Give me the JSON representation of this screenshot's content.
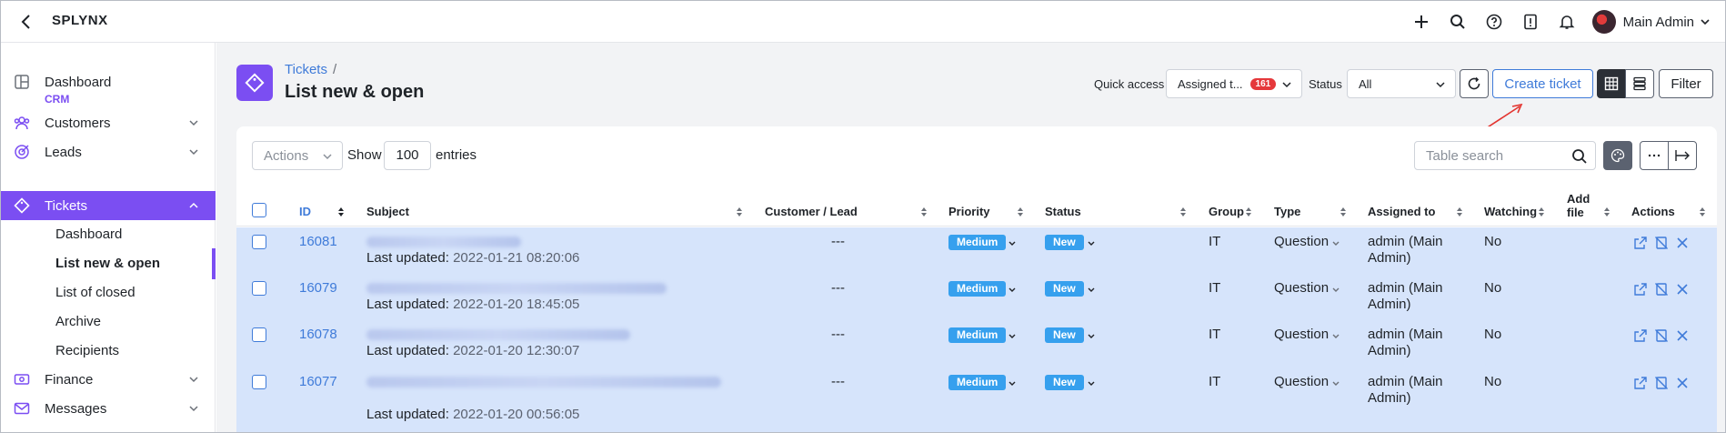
{
  "app": {
    "brand": "SPLYNX",
    "user": "Main Admin"
  },
  "sidebar": {
    "items": [
      {
        "label": "Dashboard"
      },
      {
        "label": "Customers"
      },
      {
        "label": "Leads"
      },
      {
        "label": "Tickets"
      },
      {
        "label": "Finance"
      },
      {
        "label": "Messages"
      }
    ],
    "section_crm": "CRM",
    "sub": [
      "Dashboard",
      "List new & open",
      "List of closed",
      "Archive",
      "Recipients"
    ]
  },
  "page": {
    "breadcrumb": "Tickets",
    "sep": "/",
    "title": "List new & open"
  },
  "toolbar": {
    "quick_access_label": "Quick access",
    "quick_access_value": "Assigned t...",
    "quick_access_count": "161",
    "status_label": "Status",
    "status_value": "All",
    "create_label": "Create ticket",
    "filter_label": "Filter"
  },
  "table_controls": {
    "actions_placeholder": "Actions",
    "show_label": "Show",
    "entries_value": "100",
    "entries_label": "entries",
    "search_placeholder": "Table search"
  },
  "columns": [
    "ID",
    "Subject",
    "Customer / Lead",
    "Priority",
    "Status",
    "Group",
    "Type",
    "Assigned to",
    "Watching",
    "Add file",
    "Actions"
  ],
  "rows": [
    {
      "id": "16081",
      "updated_label": "Last updated:",
      "updated": "2022-01-21 08:20:06",
      "customer": "---",
      "priority": "Medium",
      "status": "New",
      "group": "IT",
      "type": "Question",
      "assigned1": "admin (Main",
      "assigned2": "Admin)",
      "watching": "No"
    },
    {
      "id": "16079",
      "updated_label": "Last updated:",
      "updated": "2022-01-20 18:45:05",
      "customer": "---",
      "priority": "Medium",
      "status": "New",
      "group": "IT",
      "type": "Question",
      "assigned1": "admin (Main",
      "assigned2": "Admin)",
      "watching": "No"
    },
    {
      "id": "16078",
      "updated_label": "Last updated:",
      "updated": "2022-01-20 12:30:07",
      "customer": "---",
      "priority": "Medium",
      "status": "New",
      "group": "IT",
      "type": "Question",
      "assigned1": "admin (Main",
      "assigned2": "Admin)",
      "watching": "No"
    },
    {
      "id": "16077",
      "updated_label": "Last updated:",
      "updated": "2022-01-20 00:56:05",
      "customer": "---",
      "priority": "Medium",
      "status": "New",
      "group": "IT",
      "type": "Question",
      "assigned1": "admin (Main",
      "assigned2": "Admin)",
      "watching": "No"
    }
  ],
  "colors": {
    "accent": "#7b4ef2",
    "link": "#3f7bd9",
    "row_highlight": "#d6e4fb",
    "pill": "#36a0ee",
    "badge": "#e5383b"
  }
}
